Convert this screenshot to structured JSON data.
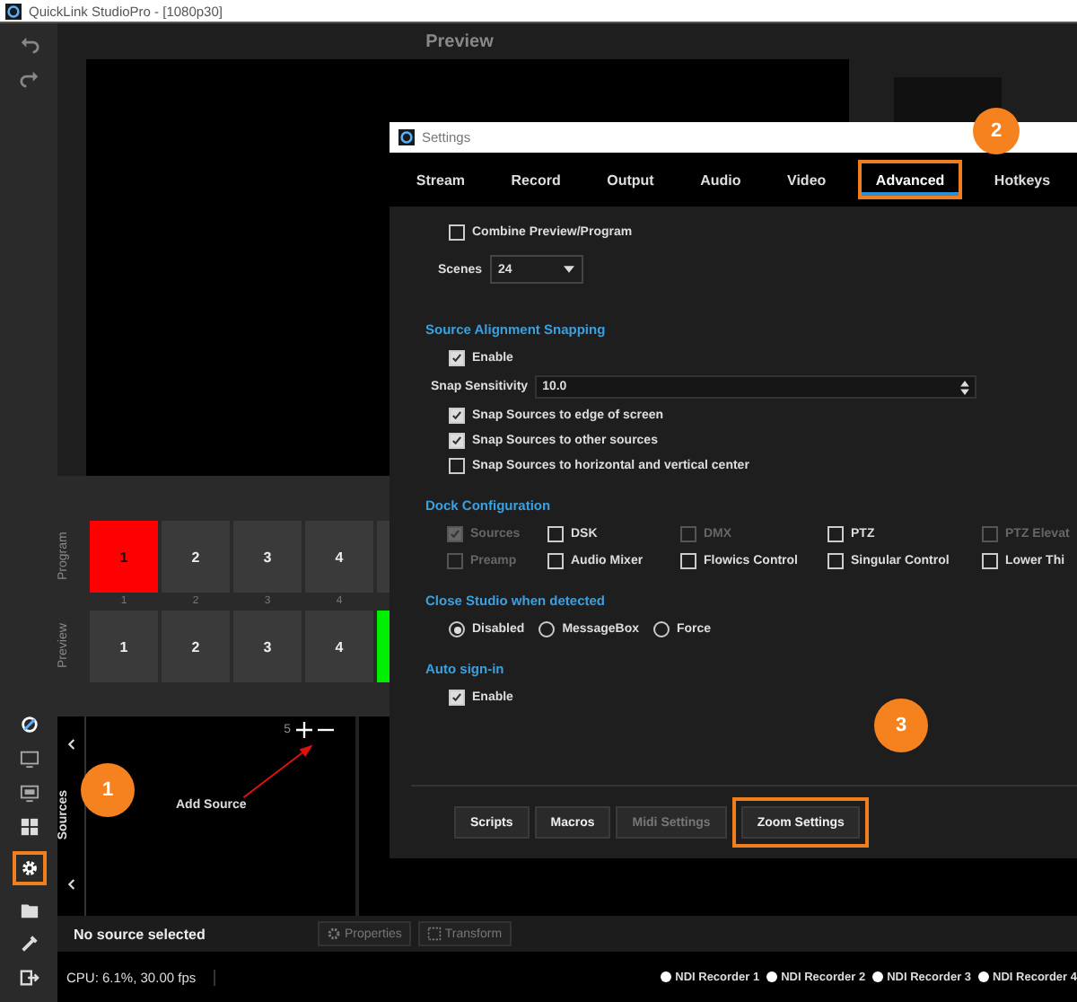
{
  "window": {
    "title": "QuickLink StudioPro  - [1080p30]"
  },
  "preview": {
    "title": "Preview"
  },
  "scenes": {
    "program": {
      "label": "Program",
      "tiles": [
        {
          "label": "1",
          "caption": "1",
          "selected": true
        },
        {
          "label": "2",
          "caption": "2",
          "selected": false
        },
        {
          "label": "3",
          "caption": "3",
          "selected": false
        },
        {
          "label": "4",
          "caption": "4",
          "selected": false
        },
        {
          "selected": false
        }
      ]
    },
    "preview": {
      "label": "Preview",
      "tiles": [
        {
          "label": "1",
          "selected": false
        },
        {
          "label": "2",
          "selected": false
        },
        {
          "label": "3",
          "selected": false
        },
        {
          "label": "4",
          "selected": false
        },
        {
          "selected": true
        }
      ]
    }
  },
  "sources": {
    "label": "Sources",
    "count": "5",
    "hint": "Add Source"
  },
  "source_bar": {
    "status": "No source selected",
    "buttons": [
      {
        "label": "Properties",
        "kind": "properties"
      },
      {
        "label": "Transform",
        "kind": "transform"
      }
    ]
  },
  "status_bar": {
    "cpu": "CPU: 6.1%, 30.00 fps",
    "recorders": [
      "NDI Recorder 1",
      "NDI Recorder 2",
      "NDI Recorder 3",
      "NDI Recorder 4"
    ]
  },
  "settings": {
    "title": "Settings",
    "tabs": [
      {
        "label": "Stream",
        "selected": false
      },
      {
        "label": "Record",
        "selected": false
      },
      {
        "label": "Output",
        "selected": false
      },
      {
        "label": "Audio",
        "selected": false
      },
      {
        "label": "Video",
        "selected": false
      },
      {
        "label": "Advanced",
        "selected": true,
        "highlighted": true
      },
      {
        "label": "Hotkeys",
        "selected": false
      }
    ],
    "combine": {
      "label": "Combine Preview/Program",
      "checked": false
    },
    "scenes": {
      "label": "Scenes",
      "value": "24"
    },
    "snapping": {
      "title": "Source Alignment Snapping",
      "enable": {
        "label": "Enable",
        "checked": true
      },
      "sensitivity": {
        "label": "Snap Sensitivity",
        "value": "10.0"
      },
      "options": [
        {
          "label": "Snap Sources to edge of screen",
          "checked": true
        },
        {
          "label": "Snap Sources to other sources",
          "checked": true
        },
        {
          "label": "Snap Sources to horizontal and vertical center",
          "checked": false
        }
      ]
    },
    "dock": {
      "title": "Dock Configuration",
      "items": [
        {
          "label": "Sources",
          "checked": true,
          "disabled": true
        },
        {
          "label": "DSK",
          "checked": false,
          "disabled": false
        },
        {
          "label": "DMX",
          "checked": false,
          "disabled": true
        },
        {
          "label": "PTZ",
          "checked": false,
          "disabled": false
        },
        {
          "label": "PTZ Elevat",
          "checked": false,
          "disabled": true
        },
        {
          "label": "Preamp",
          "checked": false,
          "disabled": true
        },
        {
          "label": "Audio Mixer",
          "checked": false,
          "disabled": false
        },
        {
          "label": "Flowics Control",
          "checked": false,
          "disabled": false
        },
        {
          "label": "Singular Control",
          "checked": false,
          "disabled": false
        },
        {
          "label": "Lower Thi",
          "checked": false,
          "disabled": false
        }
      ]
    },
    "close_studio": {
      "title": "Close Studio when detected",
      "options": [
        {
          "label": "Disabled",
          "selected": true
        },
        {
          "label": "MessageBox",
          "selected": false
        },
        {
          "label": "Force",
          "selected": false
        }
      ]
    },
    "auto_sign_in": {
      "title": "Auto sign-in",
      "enable": {
        "label": "Enable",
        "checked": true
      }
    },
    "buttons": [
      {
        "label": "Scripts",
        "disabled": false
      },
      {
        "label": "Macros",
        "disabled": false
      },
      {
        "label": "Midi Settings",
        "disabled": true
      },
      {
        "label": "Zoom Settings",
        "disabled": false,
        "highlighted": true
      }
    ]
  },
  "callouts": [
    {
      "number": "1"
    },
    {
      "number": "2"
    },
    {
      "number": "3"
    }
  ]
}
